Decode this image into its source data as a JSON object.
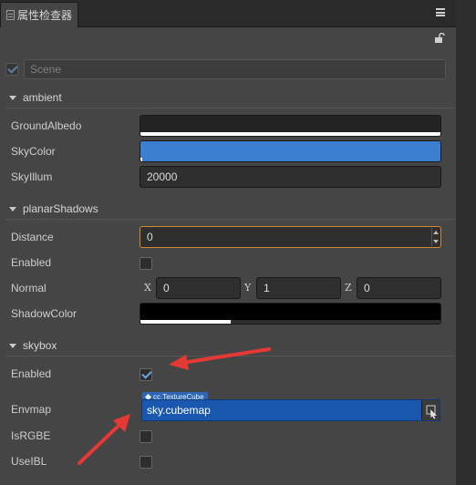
{
  "panel": {
    "tab_title": "属性检查器",
    "icons": [
      "inspector-tab-icon",
      "menu-icon",
      "lock-icon"
    ]
  },
  "scene": {
    "enabled": true,
    "name": "Scene"
  },
  "sections": {
    "ambient": {
      "label": "ambient",
      "ground_albedo": {
        "label": "GroundAlbedo",
        "color": "#232323",
        "alpha_fill": 1.0
      },
      "sky_color": {
        "label": "SkyColor",
        "color": "#3c7fd0",
        "alpha_fill": 0.0
      },
      "sky_illum": {
        "label": "SkyIllum",
        "value": "20000"
      }
    },
    "planar_shadows": {
      "label": "planarShadows",
      "distance": {
        "label": "Distance",
        "value": "0"
      },
      "enabled": {
        "label": "Enabled",
        "checked": false
      },
      "normal": {
        "label": "Normal",
        "x_label": "X",
        "x": "0",
        "y_label": "Y",
        "y": "1",
        "z_label": "Z",
        "z": "0"
      },
      "shadow_color": {
        "label": "ShadowColor",
        "color": "#000000",
        "alpha_fill": 0.3
      }
    },
    "skybox": {
      "label": "skybox",
      "enabled": {
        "label": "Enabled",
        "checked": true
      },
      "envmap": {
        "label": "Envmap",
        "asset_type": "cc.TextureCube",
        "value": "sky.cubemap"
      },
      "is_rgbe": {
        "label": "IsRGBE",
        "checked": false
      },
      "use_ibl": {
        "label": "UseIBL",
        "checked": false
      }
    }
  },
  "colors": {
    "annotation_arrow": "#e53935",
    "accent": "#1a58b0"
  }
}
